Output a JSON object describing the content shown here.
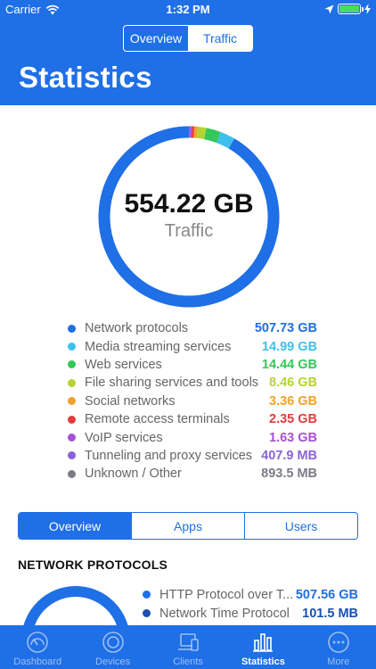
{
  "status_bar": {
    "carrier": "Carrier",
    "time": "1:32 PM"
  },
  "top_segment": {
    "items": [
      "Overview",
      "Traffic"
    ],
    "selected": "Traffic"
  },
  "page_title": "Statistics",
  "summary": {
    "total": "554.22 GB",
    "label": "Traffic"
  },
  "chart_data": {
    "type": "pie",
    "categories": [
      "Network protocols",
      "Media streaming services",
      "Web services",
      "File sharing services and tools",
      "Social networks",
      "Remote access terminals",
      "VoIP services",
      "Tunneling and proxy services",
      "Unknown / Other"
    ],
    "values": [
      507.73,
      14.99,
      14.44,
      8.46,
      3.36,
      2.35,
      1.63,
      0.4079,
      0.8935
    ],
    "unit": "GB",
    "value_labels": [
      "507.73 GB",
      "14.99 GB",
      "14.44 GB",
      "8.46 GB",
      "3.36 GB",
      "2.35 GB",
      "1.63 GB",
      "407.9 MB",
      "893.5 MB"
    ],
    "colors": [
      "#1f6fe6",
      "#3fc0ec",
      "#34c759",
      "#b5d335",
      "#f0a22e",
      "#e23b3b",
      "#a650d6",
      "#8a63d8",
      "#7c7c86"
    ],
    "legend_position": "bottom"
  },
  "bottom_segment": {
    "items": [
      "Overview",
      "Apps",
      "Users"
    ],
    "selected": "Overview"
  },
  "section_title": "NETWORK PROTOCOLS",
  "protocols": [
    {
      "name": "HTTP Protocol over T...",
      "value": "507.56 GB",
      "color": "#1f6fe6"
    },
    {
      "name": "Network Time Protocol",
      "value": "101.5 MB",
      "color": "#1a4fb4"
    }
  ],
  "tabs": [
    {
      "label": "Dashboard",
      "icon": "gauge-icon"
    },
    {
      "label": "Devices",
      "icon": "target-icon"
    },
    {
      "label": "Clients",
      "icon": "devices-icon"
    },
    {
      "label": "Statistics",
      "icon": "bar-chart-icon"
    },
    {
      "label": "More",
      "icon": "more-icon"
    }
  ],
  "active_tab": "Statistics"
}
